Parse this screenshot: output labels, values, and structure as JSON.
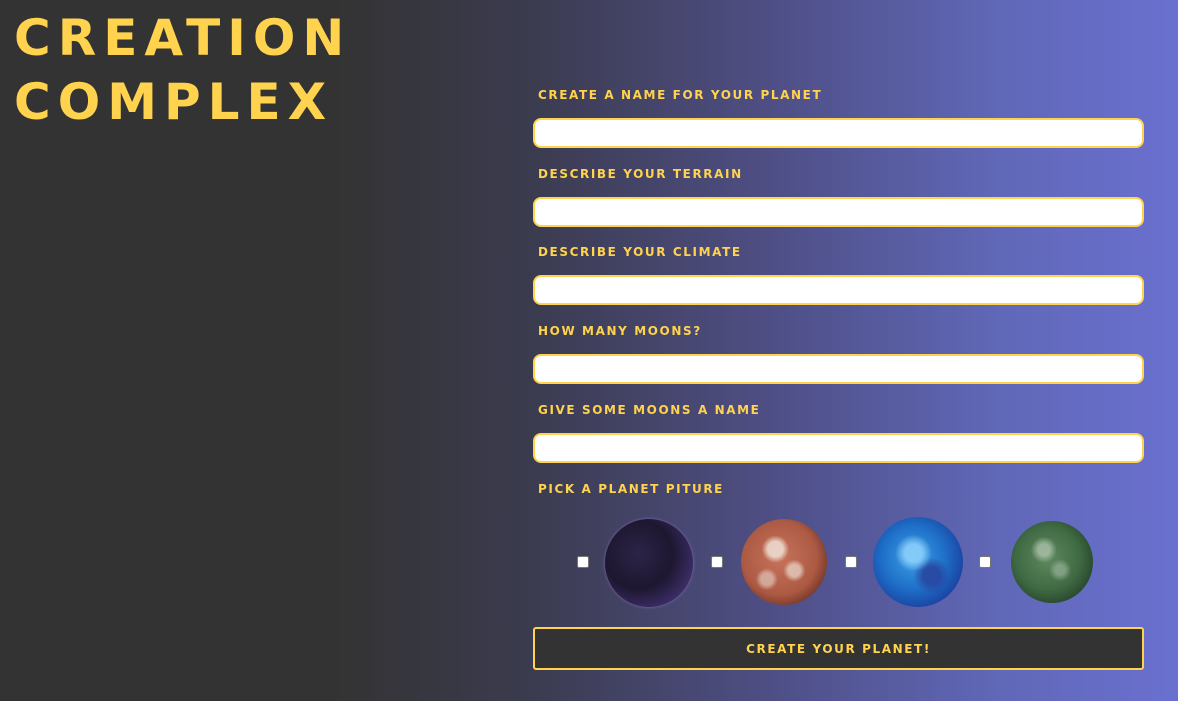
{
  "title": {
    "line1": "CREATION",
    "line2": "COMPLEX"
  },
  "form": {
    "fields": [
      {
        "label": "CREATE A NAME FOR YOUR PLANET",
        "value": "",
        "placeholder": ""
      },
      {
        "label": "DESCRIBE YOUR TERRAIN",
        "value": "",
        "placeholder": ""
      },
      {
        "label": "DESCRIBE YOUR CLIMATE",
        "value": "",
        "placeholder": ""
      },
      {
        "label": "HOW MANY MOONS?",
        "value": "",
        "placeholder": ""
      },
      {
        "label": "GIVE SOME MOONS A NAME",
        "value": "",
        "placeholder": ""
      }
    ],
    "picture_label": "PICK A PLANET PITURE",
    "planets": [
      {
        "name": "purple-planet",
        "checked": false
      },
      {
        "name": "red-planet",
        "checked": false
      },
      {
        "name": "blue-planet",
        "checked": false
      },
      {
        "name": "green-planet",
        "checked": false
      }
    ],
    "submit_label": "CREATE YOUR PLANET!"
  },
  "colors": {
    "accent": "#ffd34e",
    "background_dark": "#333333",
    "gradient_end": "#6a70cf"
  }
}
